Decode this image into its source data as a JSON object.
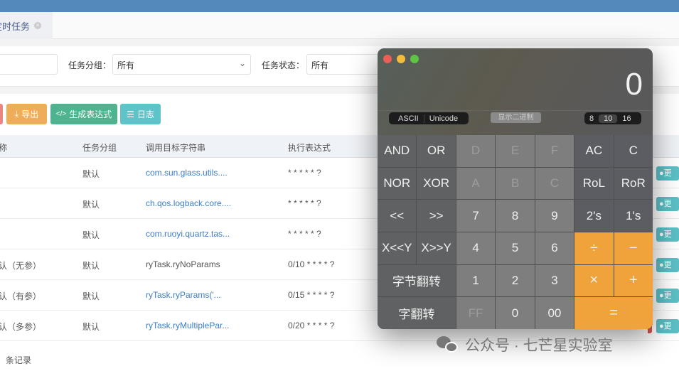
{
  "tab": {
    "label": "定时任务"
  },
  "search": {
    "group_label": "任务分组：",
    "group_value": "所有",
    "status_label": "任务状态：",
    "status_value": "所有"
  },
  "toolbar": {
    "export": "导出",
    "cron": "生成表达式",
    "log": "日志"
  },
  "table": {
    "headers": [
      "称",
      "任务分组",
      "调用目标字符串",
      "执行表达式"
    ],
    "rows": [
      {
        "name": "",
        "group": "默认",
        "target": "com.sun.glass.utils....",
        "cron": "* * * * * ?",
        "link": true
      },
      {
        "name": "",
        "group": "默认",
        "target": "ch.qos.logback.core....",
        "cron": "* * * * * ?",
        "link": true
      },
      {
        "name": "",
        "group": "默认",
        "target": "com.ruoyi.quartz.tas...",
        "cron": "* * * * * ?",
        "link": true
      },
      {
        "name": "认（无参）",
        "group": "默认",
        "target": "ryTask.ryNoParams",
        "cron": "0/10 * * * * ?",
        "link": false
      },
      {
        "name": "认（有参）",
        "group": "默认",
        "target": "ryTask.ryParams('...",
        "cron": "0/15 * * * * ?",
        "link": true
      },
      {
        "name": "认（多参）",
        "group": "默认",
        "target": "ryTask.ryMultiplePar...",
        "cron": "0/20 * * * * ?",
        "link": true
      }
    ],
    "more_label": "更多",
    "footer": "条记录"
  },
  "calculator": {
    "display": "0",
    "encodings": [
      "ASCII",
      "Unicode"
    ],
    "show_binary": "显示二进制",
    "bases": [
      "8",
      "10",
      "16"
    ],
    "active_base": "10",
    "keys": [
      "AND",
      "OR",
      "D",
      "E",
      "F",
      "AC",
      "C",
      "NOR",
      "XOR",
      "A",
      "B",
      "C",
      "RoL",
      "RoR",
      "<<",
      ">>",
      "7",
      "8",
      "9",
      "2's",
      "1's",
      "X<<Y",
      "X>>Y",
      "4",
      "5",
      "6",
      "÷",
      "−",
      "字节翻转",
      "1",
      "2",
      "3",
      "×",
      "+",
      "字翻转",
      "FF",
      "0",
      "00",
      "="
    ]
  },
  "watermark": "公众号 · 七芒星实验室"
}
